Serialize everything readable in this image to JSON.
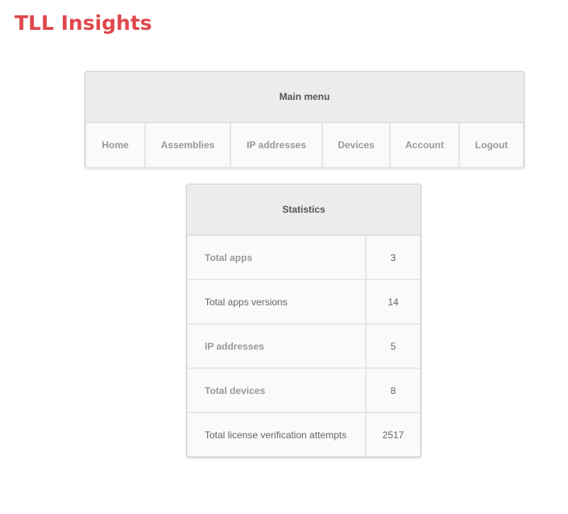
{
  "app": {
    "title": "TLL Insights",
    "accent_color": "#e0474c"
  },
  "main_menu": {
    "title": "Main menu",
    "items": [
      {
        "label": "Home"
      },
      {
        "label": "Assemblies"
      },
      {
        "label": "IP addresses"
      },
      {
        "label": "Devices"
      },
      {
        "label": "Account"
      },
      {
        "label": "Logout"
      }
    ]
  },
  "statistics": {
    "title": "Statistics",
    "rows": [
      {
        "label": "Total apps",
        "value": "3",
        "link": true
      },
      {
        "label": "Total apps versions",
        "value": "14",
        "link": false
      },
      {
        "label": "IP addresses",
        "value": "5",
        "link": true
      },
      {
        "label": "Total devices",
        "value": "8",
        "link": true
      },
      {
        "label": "Total license verification attempts",
        "value": "2517",
        "link": false
      }
    ]
  }
}
